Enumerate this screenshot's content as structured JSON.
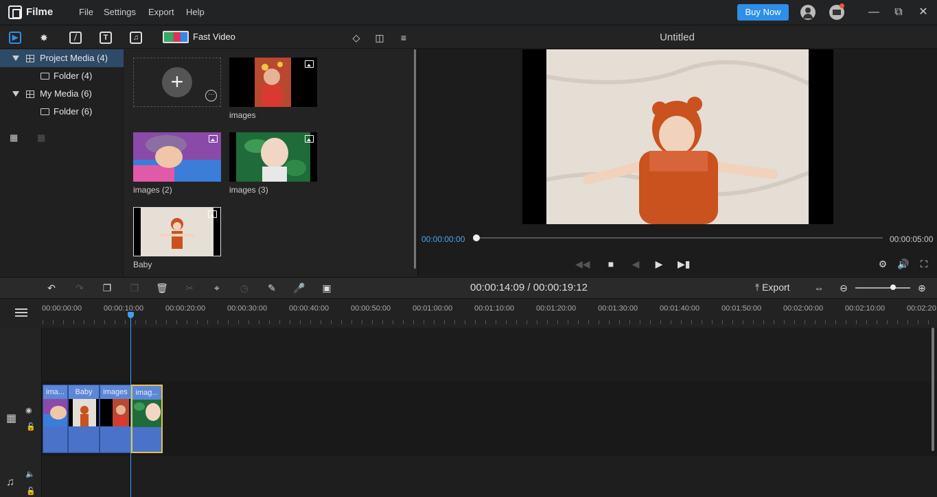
{
  "app": {
    "name": "Filme"
  },
  "menu": [
    "File",
    "Settings",
    "Export",
    "Help"
  ],
  "buy_now": "Buy Now",
  "media_toolbar": {
    "icons": [
      "media-icon",
      "effects-icon",
      "transitions-icon",
      "text-icon",
      "audio-icon"
    ],
    "fast_video": "Fast Video",
    "accent_color": "#2e8ee8"
  },
  "tree": {
    "project_media": "Project Media (4)",
    "folder1": "Folder (4)",
    "my_media": "My Media (6)",
    "folder2": "Folder (6)"
  },
  "media": {
    "items": [
      {
        "name": "images"
      },
      {
        "name": "images (2)"
      },
      {
        "name": "images (3)"
      },
      {
        "name": "Baby"
      }
    ]
  },
  "preview": {
    "title": "Untitled",
    "time_current": "00:00:00:00",
    "time_total": "00:00:05:00",
    "scrub_progress": 0
  },
  "edit_toolbar": {
    "timecode": "00:00:14:09 / 00:00:19:12",
    "export": "Export",
    "zoom_level": 0.65
  },
  "ruler": {
    "ticks": [
      "00:00:00:00",
      "00:00:10:00",
      "00:00:20:00",
      "00:00:30:00",
      "00:00:40:00",
      "00:00:50:00",
      "00:01:00:00",
      "00:01:10:00",
      "00:01:20:00",
      "00:01:30:00",
      "00:01:40:00",
      "00:01:50:00",
      "00:02:00:00",
      "00:02:10:00",
      "00:02:20:00"
    ]
  },
  "clips": [
    {
      "label": "ima..."
    },
    {
      "label": "Baby"
    },
    {
      "label": "images"
    },
    {
      "label": "imag..."
    }
  ]
}
